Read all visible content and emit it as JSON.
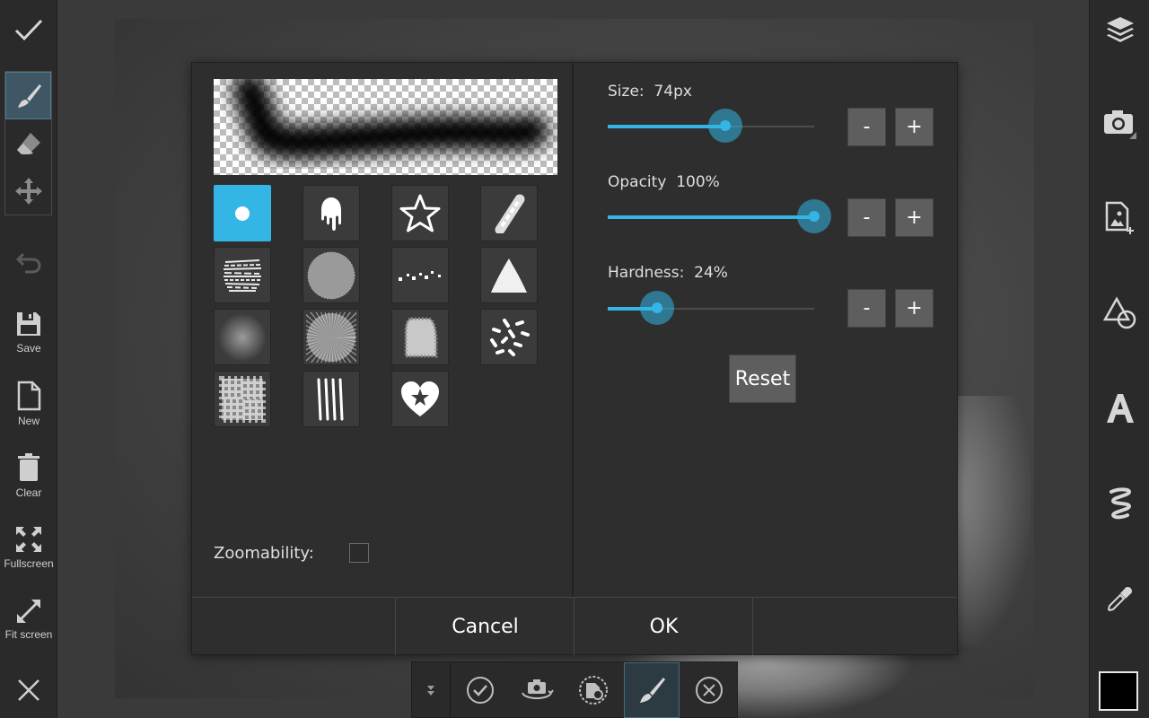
{
  "left_toolbar": {
    "save_label": "Save",
    "new_label": "New",
    "clear_label": "Clear",
    "fullscreen_label": "Fullscreen",
    "fit_label": "Fit screen"
  },
  "brush_dialog": {
    "size_label": "Size:  74px",
    "size_value": 74,
    "size_fraction": 0.57,
    "opacity_label": "Opacity  100%",
    "opacity_value": 100,
    "opacity_fraction": 1.0,
    "hardness_label": "Hardness:  24%",
    "hardness_value": 24,
    "hardness_fraction": 0.24,
    "minus_label": "-",
    "plus_label": "+",
    "reset_label": "Reset",
    "zoomability_label": "Zoomability:",
    "zoomability_checked": false,
    "cancel_label": "Cancel",
    "ok_label": "OK",
    "selected_brush": "round-dot",
    "brushes": [
      "round-dot",
      "drip",
      "star",
      "pencil-stroke",
      "dry-brush",
      "sponge",
      "scatter-dots",
      "chalk-triangle",
      "soft-round",
      "noise-round",
      "rough-texture",
      "confetti",
      "splatter-texture",
      "rake-lines",
      "heart-star"
    ]
  },
  "colors": {
    "accent": "#33b5e5",
    "dialog_bg": "#2e2e2e",
    "toolbar_bg": "#2a2a2a",
    "primary_color": "#000000"
  }
}
